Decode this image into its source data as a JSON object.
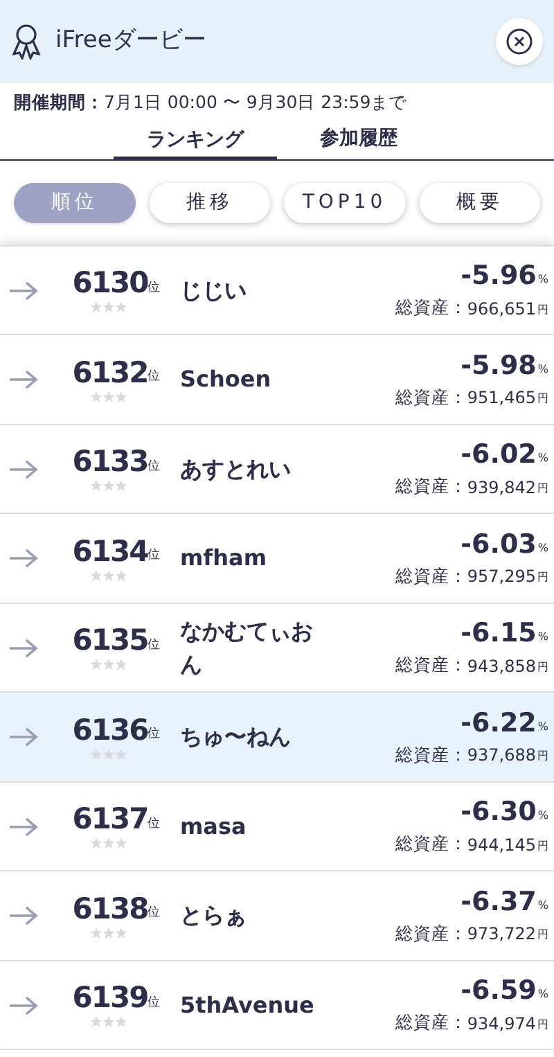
{
  "header": {
    "title": "iFreeダービー"
  },
  "period": {
    "label": "開催期間：",
    "value": "7月1日 00:00 〜 9月30日 23:59まで"
  },
  "tabs": [
    {
      "label": "ランキング",
      "selected": true
    },
    {
      "label": "参加履歴",
      "selected": false
    }
  ],
  "filters": [
    {
      "label": "順位",
      "selected": true
    },
    {
      "label": "推移",
      "selected": false
    },
    {
      "label": "TOP10",
      "selected": false
    },
    {
      "label": "概要",
      "selected": false
    }
  ],
  "rows": [
    {
      "rank": "6130",
      "rank_unit": "位",
      "stars": 0,
      "name": "じじい",
      "change": "-5.96",
      "change_unit": "%",
      "asset_label": "総資産：",
      "asset": "966,651",
      "asset_unit": "円",
      "selected": false
    },
    {
      "rank": "6132",
      "rank_unit": "位",
      "stars": 0,
      "name": "Schoen",
      "change": "-5.98",
      "change_unit": "%",
      "asset_label": "総資産：",
      "asset": "951,465",
      "asset_unit": "円",
      "selected": false
    },
    {
      "rank": "6133",
      "rank_unit": "位",
      "stars": 0,
      "name": "あすとれい",
      "change": "-6.02",
      "change_unit": "%",
      "asset_label": "総資産：",
      "asset": "939,842",
      "asset_unit": "円",
      "selected": false
    },
    {
      "rank": "6134",
      "rank_unit": "位",
      "stars": 0,
      "name": "mfham",
      "change": "-6.03",
      "change_unit": "%",
      "asset_label": "総資産：",
      "asset": "957,295",
      "asset_unit": "円",
      "selected": false
    },
    {
      "rank": "6135",
      "rank_unit": "位",
      "stars": 0,
      "name": "なかむてぃおん",
      "change": "-6.15",
      "change_unit": "%",
      "asset_label": "総資産：",
      "asset": "943,858",
      "asset_unit": "円",
      "selected": false
    },
    {
      "rank": "6136",
      "rank_unit": "位",
      "stars": 0,
      "name": "ちゅ〜ねん",
      "change": "-6.22",
      "change_unit": "%",
      "asset_label": "総資産：",
      "asset": "937,688",
      "asset_unit": "円",
      "selected": true
    },
    {
      "rank": "6137",
      "rank_unit": "位",
      "stars": 0,
      "name": "masa",
      "change": "-6.30",
      "change_unit": "%",
      "asset_label": "総資産：",
      "asset": "944,145",
      "asset_unit": "円",
      "selected": false
    },
    {
      "rank": "6138",
      "rank_unit": "位",
      "stars": 0,
      "name": "とらぁ",
      "change": "-6.37",
      "change_unit": "%",
      "asset_label": "総資産：",
      "asset": "973,722",
      "asset_unit": "円",
      "selected": false
    },
    {
      "rank": "6139",
      "rank_unit": "位",
      "stars": 0,
      "name": "5thAvenue",
      "change": "-6.59",
      "change_unit": "%",
      "asset_label": "総資産：",
      "asset": "934,974",
      "asset_unit": "円",
      "selected": false
    }
  ]
}
